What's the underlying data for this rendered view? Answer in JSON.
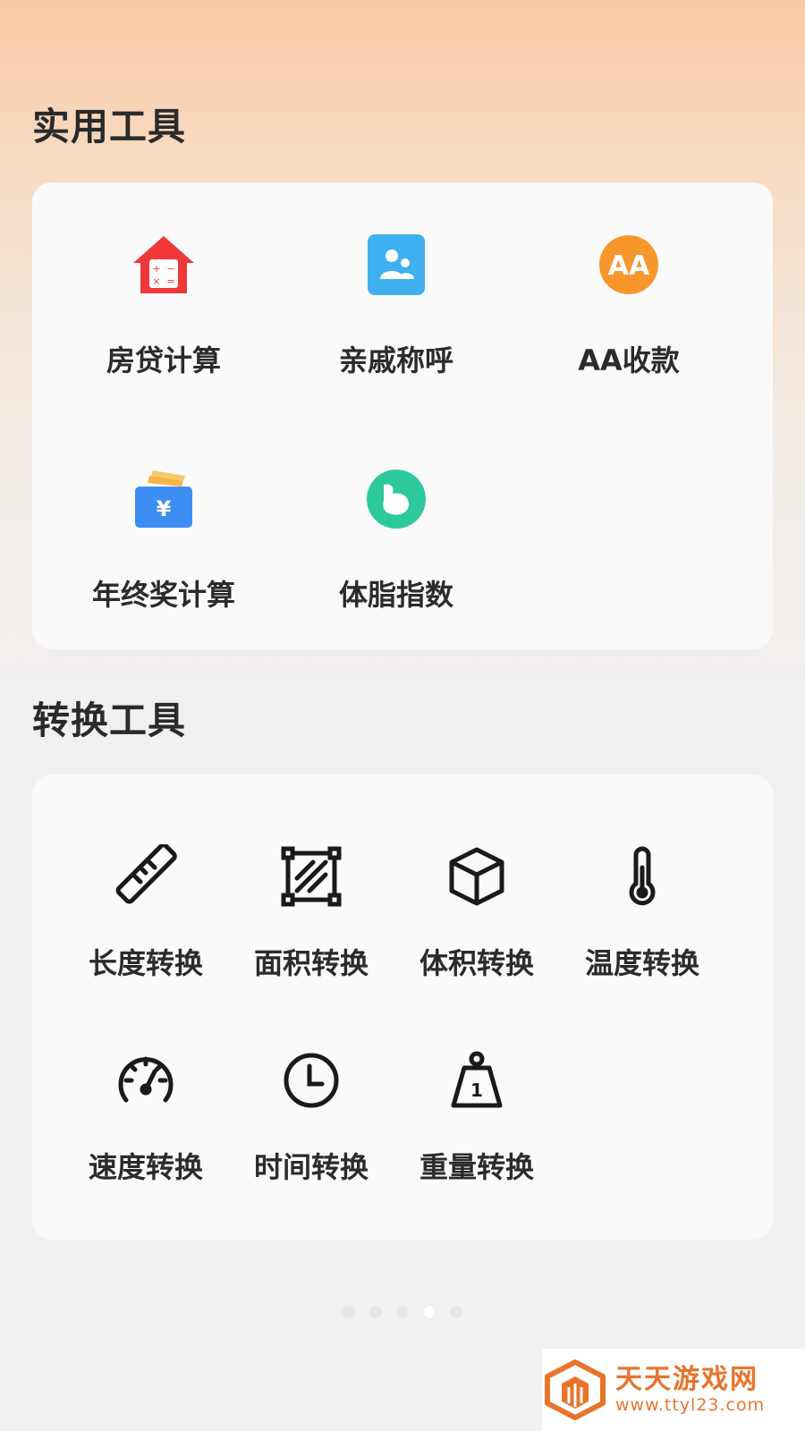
{
  "sections": {
    "utility": {
      "title": "实用工具",
      "items": [
        {
          "label": "房贷计算",
          "icon": "house-calculator-icon",
          "color": "#f0383a"
        },
        {
          "label": "亲戚称呼",
          "icon": "family-icon",
          "color": "#3fb0f0"
        },
        {
          "label": "AA收款",
          "icon": "aa-payment-icon",
          "color": "#f7962b"
        },
        {
          "label": "年终奖计算",
          "icon": "wallet-yen-icon",
          "color": "#3d8ef3"
        },
        {
          "label": "体脂指数",
          "icon": "muscle-arm-icon",
          "color": "#2ec99a"
        }
      ]
    },
    "conversion": {
      "title": "转换工具",
      "items": [
        {
          "label": "长度转换",
          "icon": "ruler-icon"
        },
        {
          "label": "面积转换",
          "icon": "area-square-icon"
        },
        {
          "label": "体积转换",
          "icon": "cube-icon"
        },
        {
          "label": "温度转换",
          "icon": "thermometer-icon"
        },
        {
          "label": "速度转换",
          "icon": "speedometer-icon"
        },
        {
          "label": "时间转换",
          "icon": "clock-icon"
        },
        {
          "label": "重量转换",
          "icon": "weight-icon"
        }
      ]
    }
  },
  "pager": {
    "count": 5,
    "active_index": 3
  },
  "watermark": {
    "title": "天天游戏网",
    "url": "www.ttyl23.com"
  }
}
